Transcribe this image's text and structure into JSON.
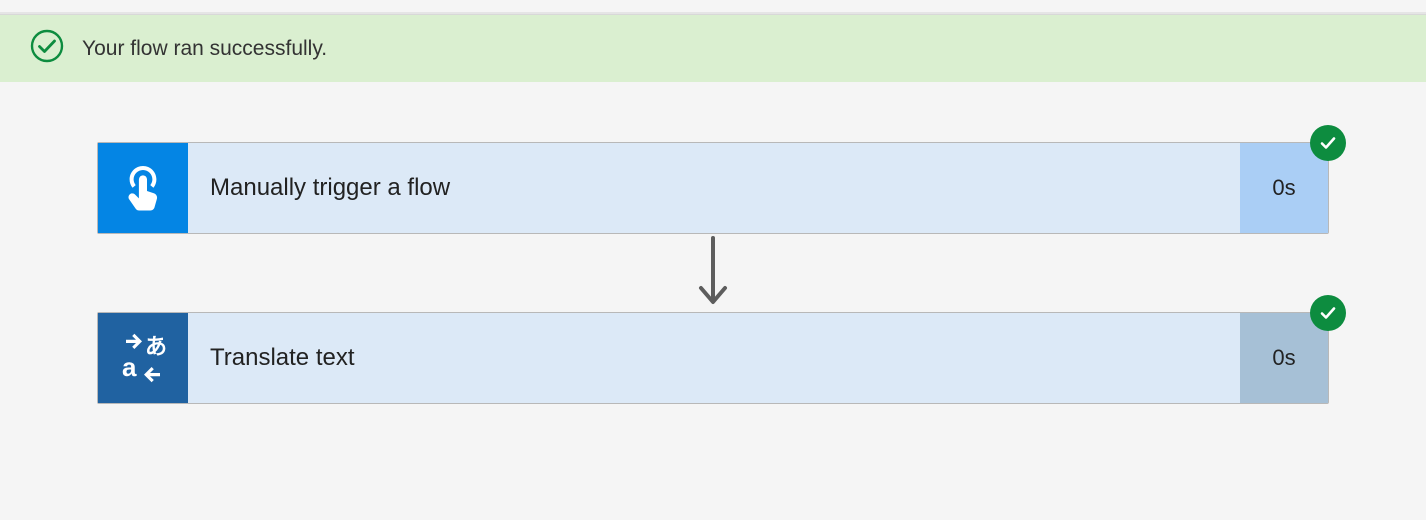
{
  "banner": {
    "message": "Your flow ran successfully.",
    "status": "success",
    "icon": "checkmark-circle",
    "accent_color": "#0d8c3f"
  },
  "steps": [
    {
      "key": "step1",
      "title": "Manually trigger a flow",
      "duration": "0s",
      "icon": "touch-icon",
      "icon_bg": "#0485e4",
      "duration_bg": "#aacef5",
      "status": "success"
    },
    {
      "key": "step2",
      "title": "Translate text",
      "duration": "0s",
      "icon": "translate-icon",
      "icon_bg": "#2062a1",
      "duration_bg": "#a6c0d6",
      "status": "success"
    }
  ]
}
